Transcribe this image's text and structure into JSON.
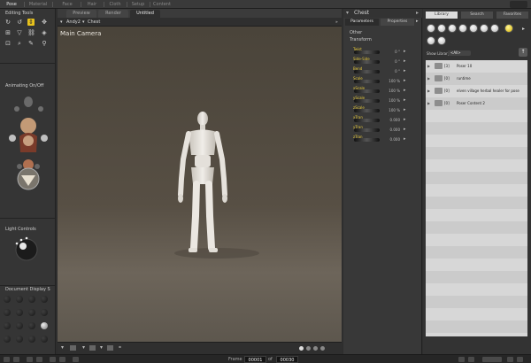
{
  "rooms": [
    "Pose",
    "Material",
    "Face",
    "Hair",
    "Cloth",
    "Setup",
    "Content"
  ],
  "left": {
    "editing_tools_title": "Editing Tools",
    "animating_title": "Animating On/Off",
    "light_title": "Light Controls",
    "document_title": "Document Display S"
  },
  "viewport": {
    "tabs": [
      "Preview",
      "Render",
      "Untitled"
    ],
    "figure_menu": "Andy2",
    "part_menu": "Chest",
    "camera": "Main Camera"
  },
  "parameters": {
    "header": "Chest",
    "tabs": [
      "Parameters",
      "Properties"
    ],
    "groups": [
      "Other",
      "Transform"
    ],
    "rows": [
      {
        "label": "Twist",
        "value": "0 °"
      },
      {
        "label": "Side-Side",
        "value": "0 °"
      },
      {
        "label": "Bend",
        "value": "0 °"
      },
      {
        "label": "Scale",
        "value": "100 %"
      },
      {
        "label": "xScale",
        "value": "100 %"
      },
      {
        "label": "yScale",
        "value": "100 %"
      },
      {
        "label": "zScale",
        "value": "100 %"
      },
      {
        "label": "xTran",
        "value": "0.000"
      },
      {
        "label": "yTran",
        "value": "0.000"
      },
      {
        "label": "zTran",
        "value": "0.000"
      }
    ]
  },
  "library": {
    "tabs": [
      "Library",
      "Search",
      "Favorites"
    ],
    "show_label": "Show Library:",
    "show_value": "<All>",
    "items": [
      {
        "count": "[3]",
        "name": "Poser 10"
      },
      {
        "count": "[0]",
        "name": "runtime"
      },
      {
        "count": "[0]",
        "name": "elven village herbal healer for pose"
      },
      {
        "count": "[0]",
        "name": "Poser Content 2"
      }
    ]
  },
  "bottom": {
    "frame_label": "Frame",
    "current_frame": "00001",
    "of_label": "of",
    "total_frames": "00030"
  },
  "colors": {
    "accent": "#e8c21c",
    "param_label": "#e6c93a",
    "library_bg": "#d7d7d7"
  }
}
